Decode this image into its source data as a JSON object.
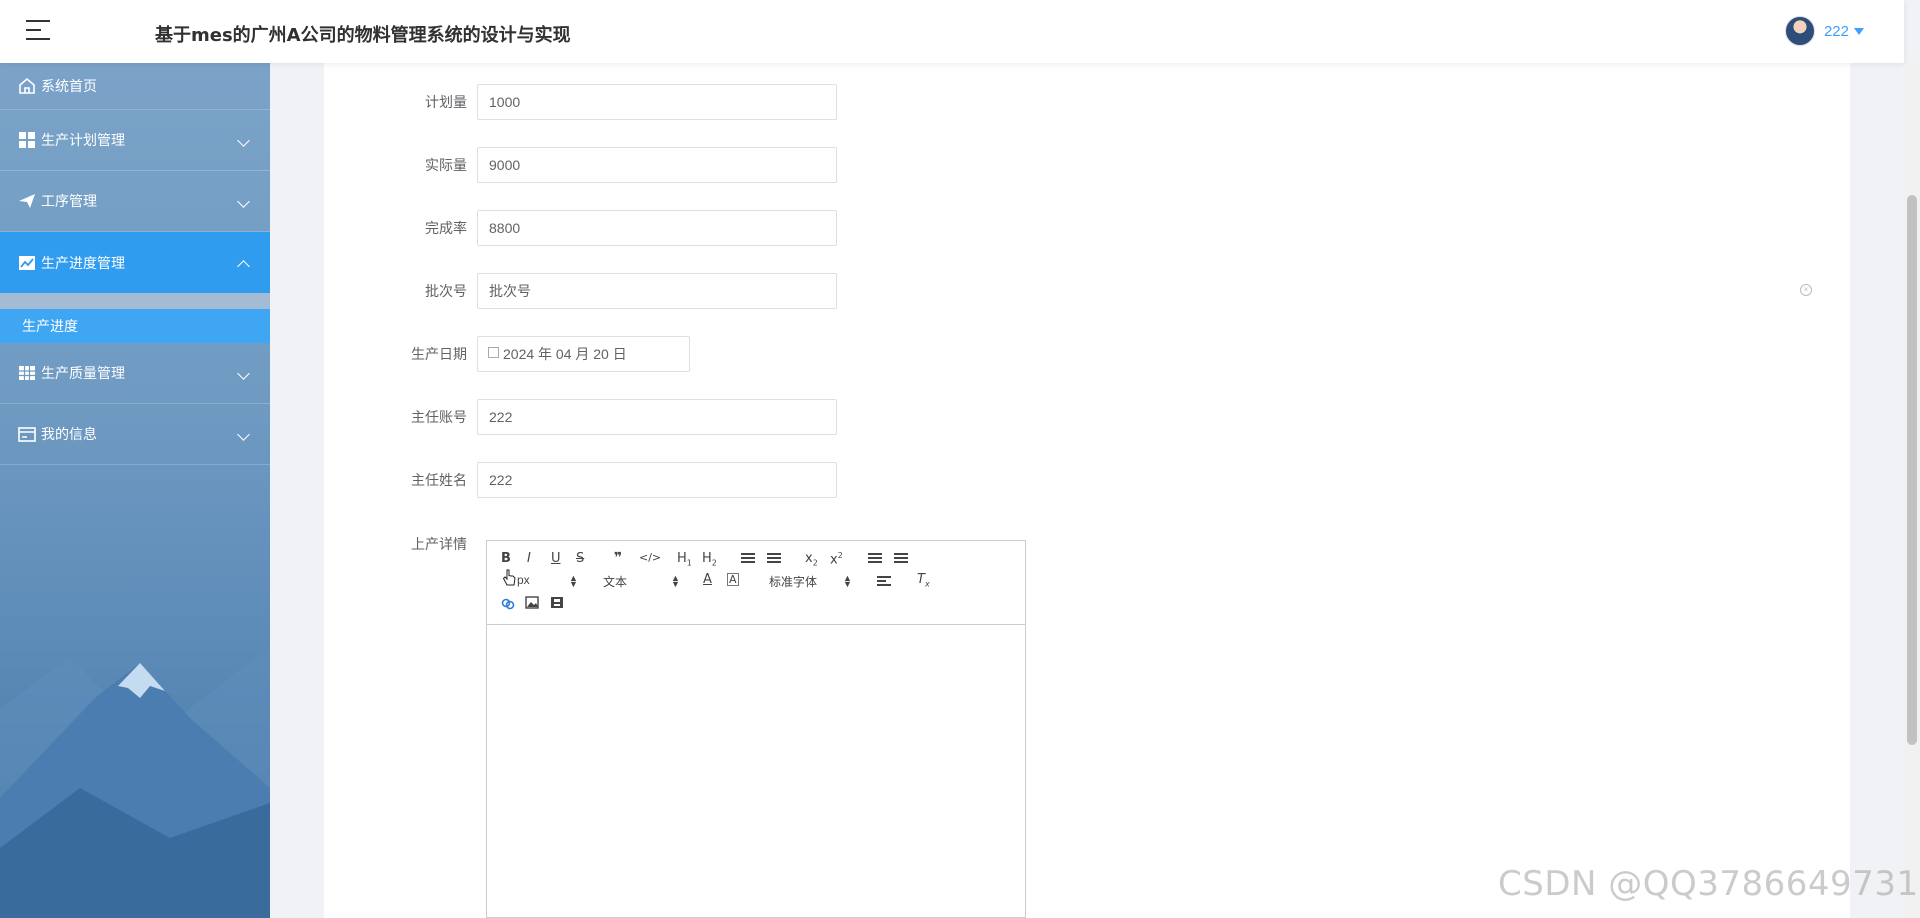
{
  "header": {
    "title": "基于mes的广州A公司的物料管理系统的设计与实现",
    "user_name": "222"
  },
  "sidebar": {
    "items": [
      {
        "label": "系统首页",
        "icon": "home-icon"
      },
      {
        "label": "生产计划管理",
        "icon": "grid-icon"
      },
      {
        "label": "工序管理",
        "icon": "send-icon"
      },
      {
        "label": "生产进度管理",
        "icon": "chart-line-icon",
        "active": true
      },
      {
        "label": "生产质量管理",
        "icon": "table-grid-icon"
      },
      {
        "label": "我的信息",
        "icon": "card-icon"
      }
    ],
    "submenu": [
      {
        "label": "生产进度"
      }
    ]
  },
  "form": {
    "planned_label": "计划量",
    "planned_value": "1000",
    "actual_label": "实际量",
    "actual_value": "9000",
    "completion_label": "完成率",
    "completion_value": "8800",
    "batch_label": "批次号",
    "batch_placeholder": "批次号",
    "date_label": "生产日期",
    "date_value": "2024 年 04 月 20 日",
    "supervisor_account_label": "主任账号",
    "supervisor_account_value": "222",
    "supervisor_name_label": "主任姓名",
    "supervisor_name_value": "222",
    "details_label": "上产详情"
  },
  "editor": {
    "size_select": "px",
    "text_select": "文本",
    "font_select": "标准字体"
  },
  "watermark": "CSDN @QQ3786649731"
}
